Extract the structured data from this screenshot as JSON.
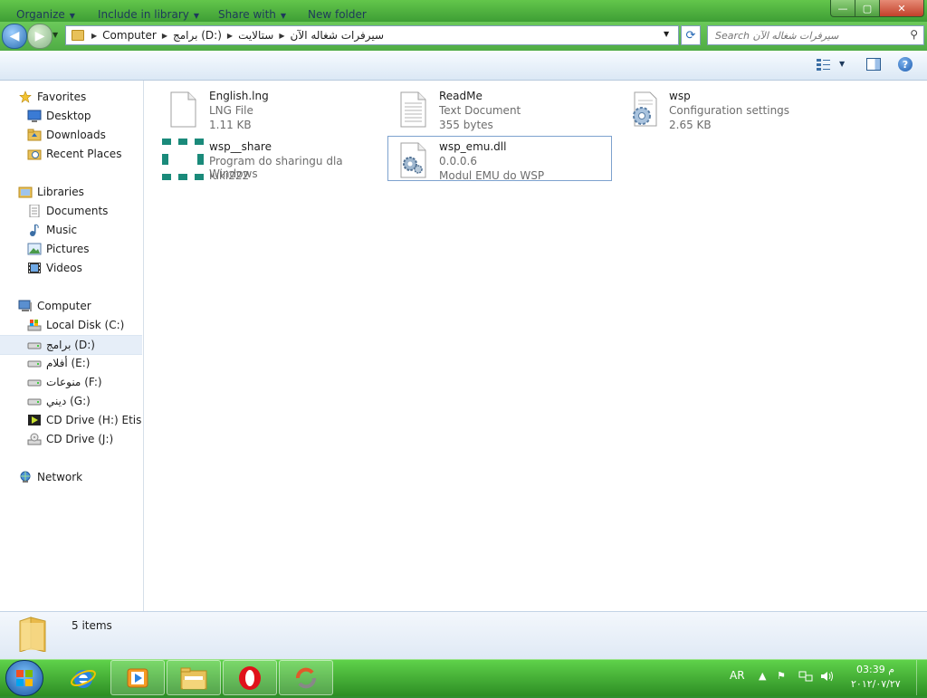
{
  "window": {
    "controls": {
      "min": "—",
      "max": "▢",
      "close": "✕"
    }
  },
  "address": {
    "segments": [
      "Computer",
      "برامج (D:)",
      "ستالايت",
      "سيرفرات شغاله الآن"
    ]
  },
  "search": {
    "placeholder": "Search سيرفرات شغاله الآن"
  },
  "toolbar": {
    "organize": "Organize",
    "include_in_library": "Include in library",
    "share_with": "Share with",
    "new_folder": "New folder"
  },
  "nav": {
    "favorites": "Favorites",
    "desktop": "Desktop",
    "downloads": "Downloads",
    "recent_places": "Recent Places",
    "libraries": "Libraries",
    "documents": "Documents",
    "music": "Music",
    "pictures": "Pictures",
    "videos": "Videos",
    "computer": "Computer",
    "drive_c": "Local Disk (C:)",
    "drive_d": "برامج (D:)",
    "drive_e": "أفلام (E:)",
    "drive_f": "منوعات (F:)",
    "drive_g": "ديني (G:)",
    "drive_h": "CD Drive (H:) Etisalat",
    "drive_j": "CD Drive (J:)",
    "network": "Network"
  },
  "files": [
    {
      "name": "English.lng",
      "type": "LNG File",
      "detail": "1.11 KB"
    },
    {
      "name": "ReadMe",
      "type": "Text Document",
      "detail": "355 bytes"
    },
    {
      "name": "wsp",
      "type": "Configuration settings",
      "detail": "2.65 KB"
    },
    {
      "name": "wsp__share",
      "type": "Program do sharingu dla Windows",
      "detail": "luki222"
    },
    {
      "name": "wsp_emu.dll",
      "type": "0.0.0.6",
      "detail": "Modul EMU do WSP"
    }
  ],
  "details": {
    "item_count": "5 items"
  },
  "taskbar": {
    "language": "AR",
    "time": "03:39 م",
    "date": "٢٠١٢/٠٧/٢٧"
  },
  "icons": {
    "tray": [
      "arrow-up-icon",
      "flag-icon",
      "network-icon",
      "speaker-icon"
    ]
  }
}
